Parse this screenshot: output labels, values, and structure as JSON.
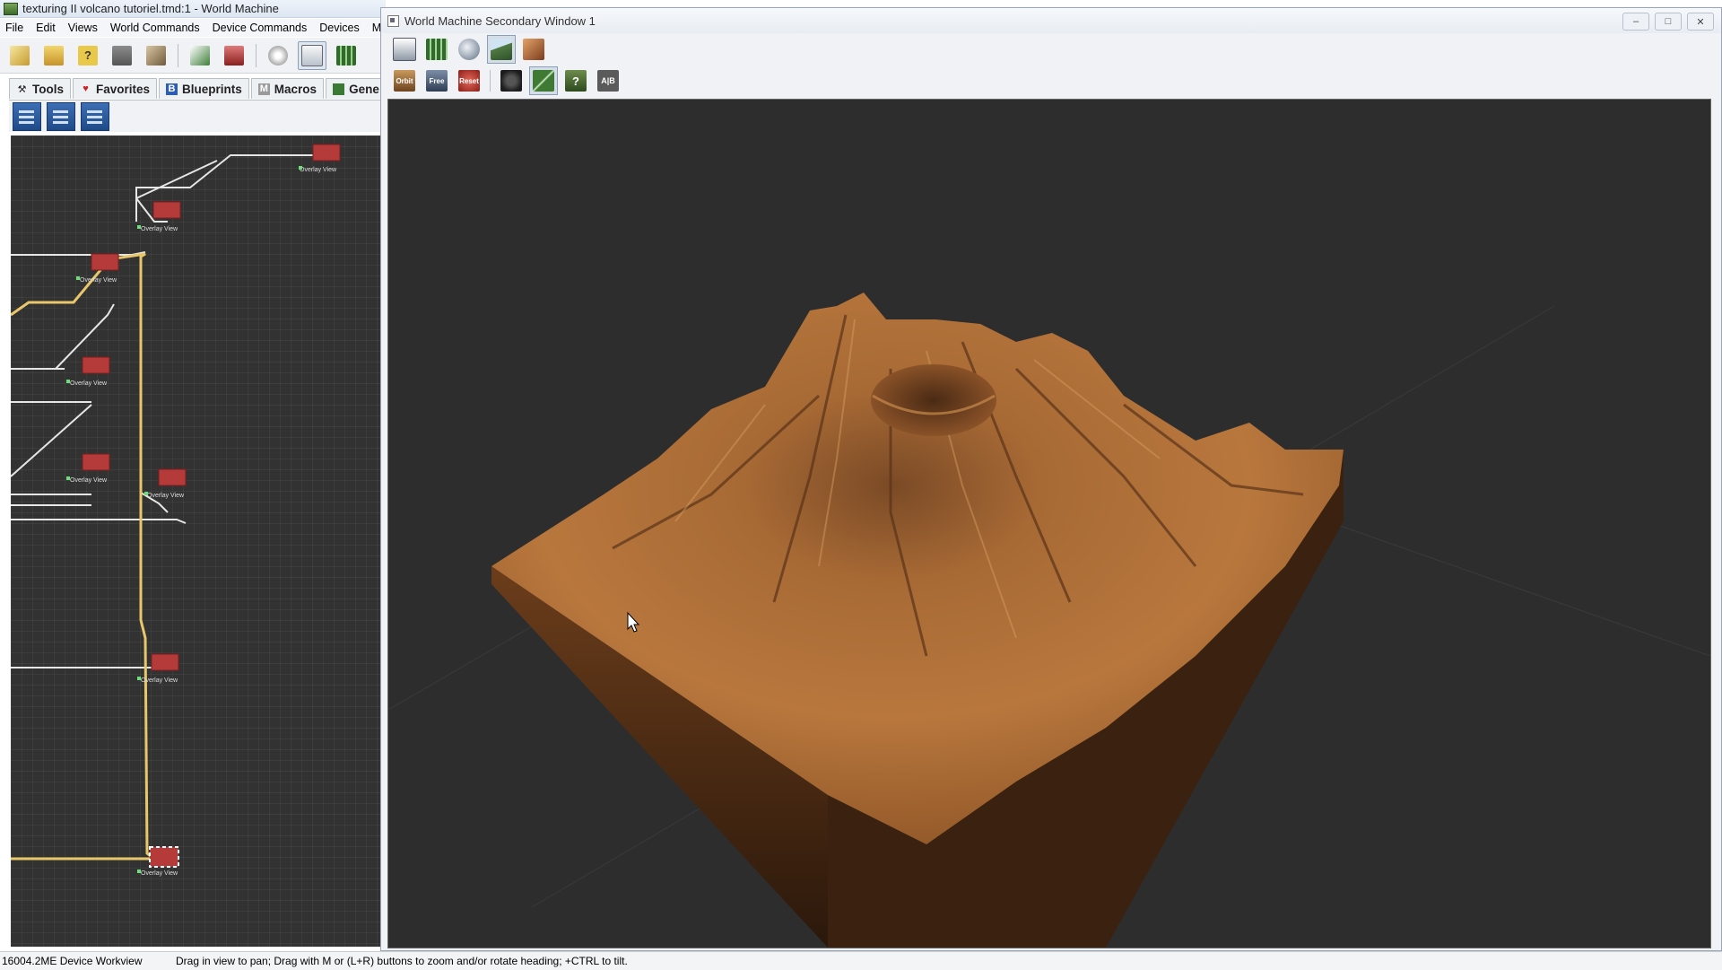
{
  "main_window": {
    "title": "texturing II volcano tutoriel.tmd:1 - World Machine",
    "app_icon": "world-machine-icon"
  },
  "menubar": {
    "items": [
      "File",
      "Edit",
      "Views",
      "World Commands",
      "Device Commands",
      "Devices",
      "Mac"
    ]
  },
  "toolbar": {
    "buttons": [
      {
        "name": "new-world-icon"
      },
      {
        "name": "open-folder-icon"
      },
      {
        "name": "help-icon"
      },
      {
        "name": "save-icon"
      },
      {
        "name": "save-as-icon"
      },
      {
        "name": "export-icon"
      },
      {
        "name": "world-settings-icon"
      },
      {
        "name": "random-seed-icon"
      },
      {
        "name": "device-workview-icon",
        "active": true
      },
      {
        "name": "layout-view-icon"
      }
    ]
  },
  "palette_tabs": [
    {
      "label": "Tools",
      "icon": "tools-icon"
    },
    {
      "label": "Favorites",
      "icon": "heart-icon"
    },
    {
      "label": "Blueprints",
      "icon": "blueprint-icon",
      "glyph": "B"
    },
    {
      "label": "Macros",
      "icon": "macro-icon",
      "glyph": "M"
    },
    {
      "label": "Gene",
      "icon": "generator-icon"
    }
  ],
  "workview": {
    "node_labels": [
      "Overlay View",
      "Overlay View",
      "Overlay View",
      "Overlay View",
      "Overlay View",
      "Overlay View",
      "Overlay View",
      "Overlay View",
      "Overlay View"
    ]
  },
  "statusbar": {
    "left": "16004.2ME Device Workview",
    "hint": "Drag in view to pan; Drag with M or (L+R) buttons to zoom and/or rotate heading; +CTRL to tilt."
  },
  "secondary_window": {
    "title": "World Machine Secondary Window 1",
    "toolbar1": [
      {
        "name": "view-settings-icon"
      },
      {
        "name": "texture-grid-icon"
      },
      {
        "name": "sphere-view-icon"
      },
      {
        "name": "terrain-view-icon",
        "active": true
      },
      {
        "name": "paint-texture-icon"
      }
    ],
    "toolbar2": [
      {
        "name": "orbit-icon",
        "label": "Orbit"
      },
      {
        "name": "free-camera-icon",
        "label": "Free"
      },
      {
        "name": "reset-camera-icon",
        "label": "Reset"
      },
      {
        "name": "camera-icon"
      },
      {
        "name": "wireframe-icon",
        "active": true
      },
      {
        "name": "lighting-help-icon"
      },
      {
        "name": "compare-ab-icon",
        "label": "A|B"
      }
    ]
  },
  "colors": {
    "workview_bg": "#323232",
    "viewport_bg": "#2d2d2d",
    "node_red": "#b53b3b",
    "wire_yellow": "#e8c66a",
    "terrain_brown": "#a0622c"
  }
}
